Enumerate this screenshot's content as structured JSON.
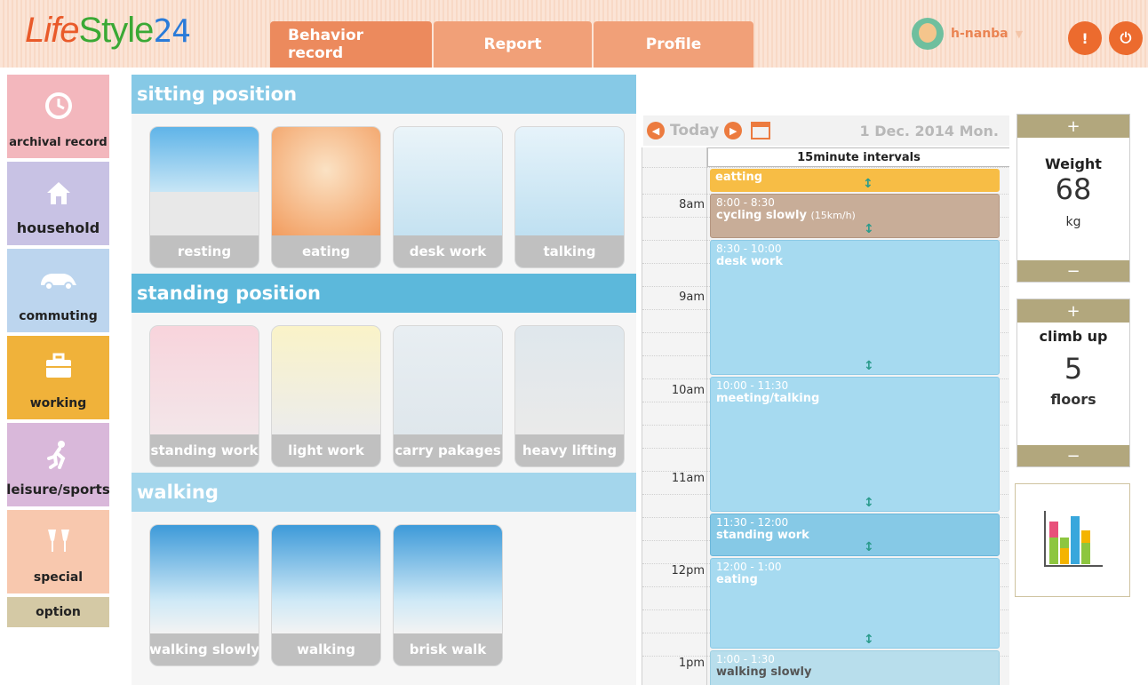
{
  "app": {
    "logo_prefix": "Life",
    "logo_main": "Style",
    "logo_num": "24"
  },
  "nav": {
    "tabs": [
      {
        "label": "Behavior record",
        "active": true
      },
      {
        "label": "Report",
        "active": false
      },
      {
        "label": "Profile",
        "active": false
      }
    ]
  },
  "user": {
    "name": "h-nanba",
    "alert_icon": "!",
    "power_icon": "⏻"
  },
  "sidebar": {
    "items": [
      {
        "label": "archival record",
        "icon": "clock-icon",
        "color": "#f3b7bd"
      },
      {
        "label": "household",
        "icon": "house-icon",
        "color": "#c8c2e4"
      },
      {
        "label": "commuting",
        "icon": "car-icon",
        "color": "#bcd5ee"
      },
      {
        "label": "working",
        "icon": "briefcase-icon",
        "color": "#f0b23a"
      },
      {
        "label": "leisure/sports",
        "icon": "runner-icon",
        "color": "#d9b8da"
      },
      {
        "label": "special",
        "icon": "toast-icon",
        "color": "#f8c8ae"
      }
    ],
    "option_label": "option"
  },
  "sections": [
    {
      "title": "sitting position",
      "cards": [
        "resting",
        "eating",
        "desk work",
        "talking"
      ]
    },
    {
      "title": "standing position",
      "cards": [
        "standing work",
        "light work",
        "carry pakages",
        "heavy lifting"
      ]
    },
    {
      "title": "walking",
      "cards": [
        "walking slowly",
        "walking",
        "brisk walk"
      ]
    }
  ],
  "calendar": {
    "today_label": "Today",
    "date": "1 Dec. 2014  Mon.",
    "interval_label": "15minute intervals",
    "hours": [
      "8am",
      "9am",
      "10am",
      "11am",
      "12pm",
      "1pm"
    ],
    "events": [
      {
        "time": "",
        "name": "eatting",
        "sub": "",
        "color": "#f7bd45"
      },
      {
        "time": "8:00 - 8:30",
        "name": "cycling slowly",
        "sub": "(15km/h)",
        "color": "#c8ad98"
      },
      {
        "time": "8:30 - 10:00",
        "name": "desk work",
        "sub": "",
        "color": "#a6daf0"
      },
      {
        "time": "10:00 - 11:30",
        "name": "meeting/talking",
        "sub": "",
        "color": "#a6daf0"
      },
      {
        "time": "11:30 - 12:00",
        "name": "standing work",
        "sub": "",
        "color": "#86c9e6"
      },
      {
        "time": "12:00 - 1:00",
        "name": "eating",
        "sub": "",
        "color": "#a6daf0"
      },
      {
        "time": "1:00 - 1:30",
        "name": "walking slowly",
        "sub": "",
        "color": "#b8deec"
      }
    ]
  },
  "counters": {
    "plus": "+",
    "minus": "−",
    "weight": {
      "label": "Weight",
      "value": "68",
      "unit": "kg"
    },
    "climb": {
      "label": "climb up",
      "value": "5",
      "unit": "floors"
    }
  }
}
